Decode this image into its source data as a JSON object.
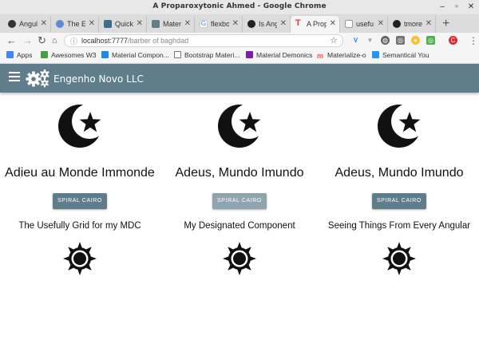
{
  "window": {
    "title": "A Proparoxytonic Ahmed - Google Chrome"
  },
  "tabs": [
    {
      "label": "Angul",
      "fav_color": "#333333"
    },
    {
      "label": "The E",
      "fav_color": "#5b8bd6"
    },
    {
      "label": "Quick",
      "fav_color": "#3a6e8f"
    },
    {
      "label": "Mater",
      "fav_color": "#607d8b"
    },
    {
      "label": "flexbo",
      "fav_color": "#4285f4"
    },
    {
      "label": "Is Ang",
      "fav_color": "#222222"
    },
    {
      "label": "A Prop",
      "fav_color": "#e53935"
    },
    {
      "label": "usefu",
      "fav_color": "#888888"
    },
    {
      "label": "tmore",
      "fav_color": "#222222"
    }
  ],
  "toolbar": {
    "url_host": "localhost:",
    "url_port": "7777",
    "url_path": "/barber of baghdad",
    "extensions": [
      {
        "label": "V",
        "color": "#1e88e5"
      },
      {
        "label": "▼",
        "color": "#9e9e9e"
      },
      {
        "label": "◍",
        "color": "#616161"
      },
      {
        "label": "◎",
        "color": "#757575"
      },
      {
        "label": "●",
        "color": "#fbc02d"
      },
      {
        "label": "◎",
        "color": "#4caf50"
      },
      {
        "label": "C",
        "color": "#d32f2f"
      }
    ]
  },
  "bookmarks": [
    {
      "label": "Apps",
      "color": "#4285f4"
    },
    {
      "label": "Awesomes W3",
      "color": "#43a047"
    },
    {
      "label": "Material Compon...",
      "color": "#1e88e5"
    },
    {
      "label": "Bootstrap Materi...",
      "color": "#ffffff"
    },
    {
      "label": "Material Demonics",
      "color": "#7b1fa2"
    },
    {
      "label": "Materialize-o",
      "color": "#ef5350"
    },
    {
      "label": "Semantical You",
      "color": "#2196f3"
    }
  ],
  "appbar": {
    "brand": "Engenho Novo LLC"
  },
  "cards": [
    {
      "heading": "Adieu au Monde Immonde",
      "button": "SPIRAL CAIRO",
      "subheading": "The Usefully Grid for my MDC",
      "disabled": false
    },
    {
      "heading": "Adeus, Mundo Imundo",
      "button": "SPIRAL CAIRO",
      "subheading": "My Designated Component",
      "disabled": true
    },
    {
      "heading": "Adeus, Mundo Imundo",
      "button": "SPIRAL CAIRO",
      "subheading": "Seeing Things From Every Angular",
      "disabled": false
    }
  ],
  "icons": {
    "moon": "moon-star-icon",
    "sun": "sun-icon",
    "gears": "gears-icon"
  }
}
